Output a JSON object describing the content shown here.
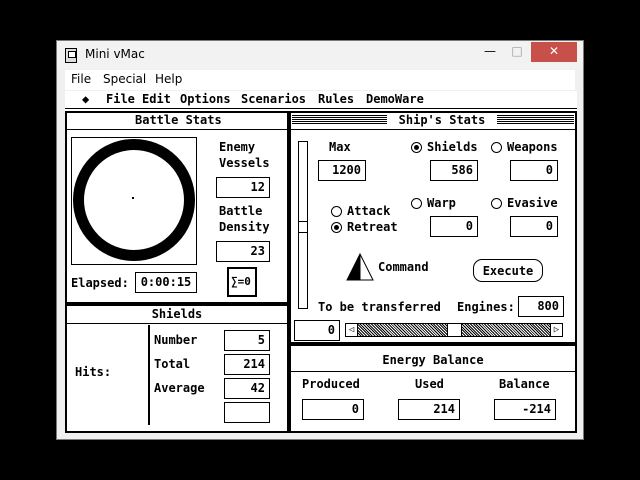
{
  "window": {
    "title": "Mini vMac",
    "menu": [
      "File",
      "Special",
      "Help"
    ],
    "minimize": "—",
    "maximize": "□",
    "close": "✕"
  },
  "mac_menu": {
    "items": [
      "File",
      "Edit",
      "Options",
      "Scenarios",
      "Rules",
      "DemoWare"
    ]
  },
  "battle_stats": {
    "title": "Battle Stats",
    "enemy_label_1": "Enemy",
    "enemy_label_2": "Vessels",
    "enemy_value": "12",
    "density_label_1": "Battle",
    "density_label_2": "Density",
    "density_value": "23",
    "elapsed_label": "Elapsed:",
    "elapsed_value": "0:00:15",
    "sigma_label": "∑=0"
  },
  "shields_panel": {
    "title": "Shields",
    "hits_label": "Hits:",
    "number_label": "Number",
    "number_value": "5",
    "total_label": "Total",
    "total_value": "214",
    "average_label": "Average",
    "average_value": "42",
    "extra_value": ""
  },
  "ships_stats": {
    "title": "Ship's Stats",
    "max_label": "Max",
    "max_value": "1200",
    "shields_label": "Shields",
    "shields_value": "586",
    "weapons_label": "Weapons",
    "weapons_value": "0",
    "warp_label": "Warp",
    "warp_value": "0",
    "evasive_label": "Evasive",
    "evasive_value": "0",
    "attack_label": "Attack",
    "retreat_label": "Retreat",
    "command_label": "Command",
    "execute_label": "Execute",
    "transfer_label": "To be transferred",
    "transfer_value": "0",
    "engines_label": "Engines:",
    "engines_value": "800",
    "selected_system": "Shields",
    "selected_mode": "Retreat",
    "slider_level": 0.5
  },
  "energy_balance": {
    "title": "Energy Balance",
    "produced_label": "Produced",
    "produced_value": "0",
    "used_label": "Used",
    "used_value": "214",
    "balance_label": "Balance",
    "balance_value": "-214"
  }
}
